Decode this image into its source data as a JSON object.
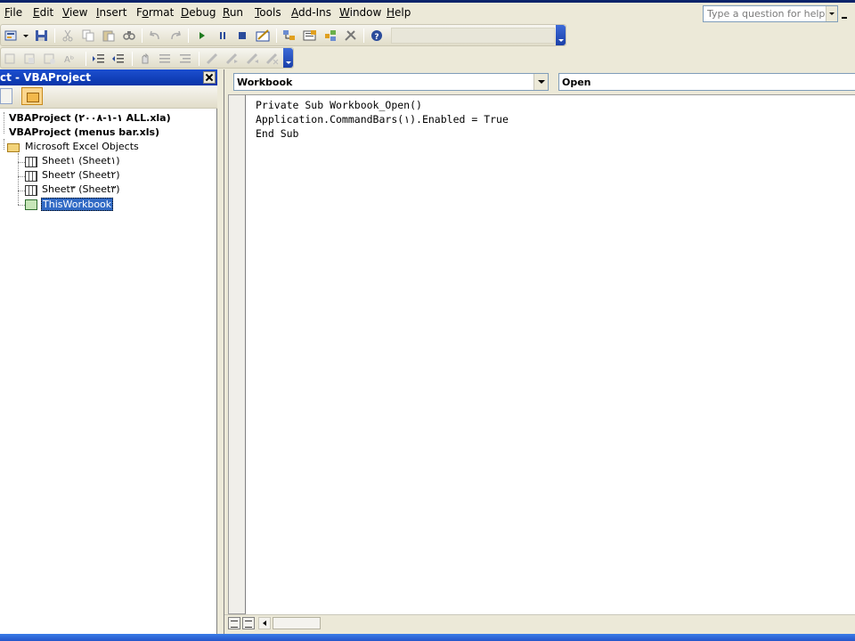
{
  "menu": {
    "items": [
      {
        "u": "F",
        "rest": "ile"
      },
      {
        "u": "E",
        "rest": "dit"
      },
      {
        "u": "V",
        "rest": "iew"
      },
      {
        "u": "I",
        "rest": "nsert"
      },
      {
        "pre": "F",
        "u": "o",
        "rest": "rmat"
      },
      {
        "u": "D",
        "rest": "ebug"
      },
      {
        "u": "R",
        "rest": "un"
      },
      {
        "u": "T",
        "rest": "ools"
      },
      {
        "u": "A",
        "rest": "dd-Ins"
      },
      {
        "u": "W",
        "rest": "indow"
      },
      {
        "u": "H",
        "rest": "elp"
      }
    ],
    "ask_placeholder": "Type a question for help"
  },
  "toolbar1": {
    "icons": [
      "insert-module-icon",
      "dropdown-icon",
      "save-icon",
      "cut-icon",
      "copy-icon",
      "paste-icon",
      "find-icon",
      "undo-icon",
      "redo-icon",
      "run-icon",
      "break-icon",
      "reset-icon",
      "design-mode-icon",
      "project-explorer-icon",
      "properties-icon",
      "object-browser-icon",
      "toolbox-icon",
      "help-icon"
    ]
  },
  "toolbar2": {
    "icons": [
      "list-properties-icon",
      "list-constants-icon",
      "quick-info-icon",
      "parameter-info-icon",
      "complete-word-icon",
      "indent-icon",
      "outdent-icon",
      "toggle-breakpoint-icon",
      "comment-block-icon",
      "uncomment-block-icon",
      "toggle-bookmark-icon",
      "next-bookmark-icon",
      "previous-bookmark-icon",
      "clear-bookmarks-icon"
    ]
  },
  "project_explorer": {
    "title": "ct - VBAProject",
    "nodes": {
      "p1": "VBAProject (١-١-٢٠٠٨ ALL.xla)",
      "p2": "VBAProject (menus bar.xls)",
      "folder": "Microsoft Excel Objects",
      "s1": "Sheet١ (Sheet١)",
      "s2": "Sheet٢ (Sheet٢)",
      "s3": "Sheet٣ (Sheet٣)",
      "wb": "ThisWorkbook"
    },
    "selected": "ThisWorkbook"
  },
  "code_window": {
    "object": "Workbook",
    "procedure": "Open",
    "lines": [
      "Private Sub Workbook_Open()",
      "Application.CommandBars(١).Enabled = True",
      "End Sub"
    ]
  }
}
